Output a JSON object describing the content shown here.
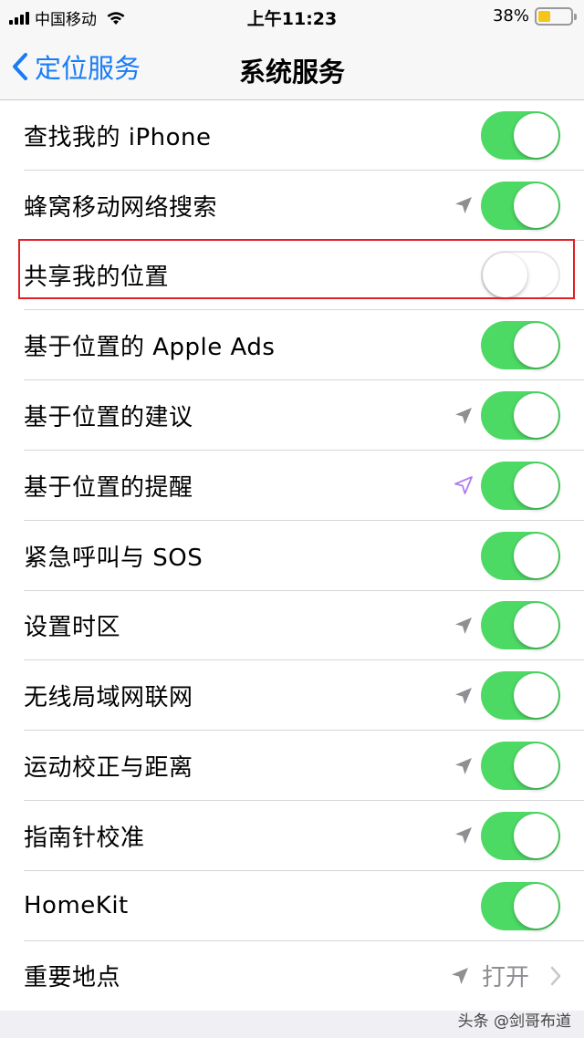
{
  "status_bar": {
    "carrier": "中国移动",
    "time": "上午11:23",
    "battery_percent": "38%",
    "battery_level": 0.38,
    "battery_color": "#f5c518"
  },
  "nav": {
    "back_label": "定位服务",
    "title": "系统服务"
  },
  "accent_color": "#1a7cf5",
  "toggle_on_color": "#4cd964",
  "rows": [
    {
      "label": "查找我的 iPhone",
      "toggle": "on",
      "location_icon": "none"
    },
    {
      "label": "蜂窝移动网络搜索",
      "toggle": "on",
      "location_icon": "gray-arrow"
    },
    {
      "label": "共享我的位置",
      "toggle": "off",
      "location_icon": "none"
    },
    {
      "label": "基于位置的 Apple Ads",
      "toggle": "on",
      "location_icon": "none"
    },
    {
      "label": "基于位置的建议",
      "toggle": "on",
      "location_icon": "gray-arrow"
    },
    {
      "label": "基于位置的提醒",
      "toggle": "on",
      "location_icon": "purple-outline-arrow"
    },
    {
      "label": "紧急呼叫与 SOS",
      "toggle": "on",
      "location_icon": "none"
    },
    {
      "label": "设置时区",
      "toggle": "on",
      "location_icon": "gray-arrow"
    },
    {
      "label": "无线局域网联网",
      "toggle": "on",
      "location_icon": "gray-arrow"
    },
    {
      "label": "运动校正与距离",
      "toggle": "on",
      "location_icon": "gray-arrow"
    },
    {
      "label": "指南针校准",
      "toggle": "on",
      "location_icon": "gray-arrow"
    },
    {
      "label": "HomeKit",
      "toggle": "on",
      "location_icon": "none"
    },
    {
      "label": "重要地点",
      "value": "打开",
      "location_icon": "gray-arrow"
    }
  ],
  "highlight_color": "#e21e26",
  "watermark": "头条 @剑哥布道"
}
